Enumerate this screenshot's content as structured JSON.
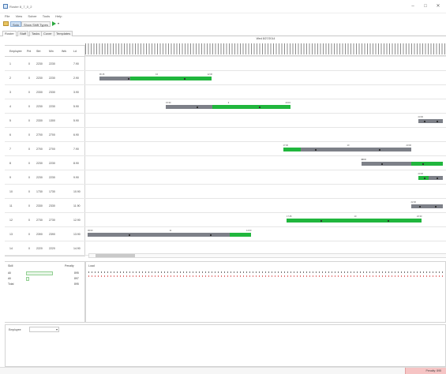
{
  "window": {
    "title": "Roster 8_7_0_2"
  },
  "menu": [
    "File",
    "View",
    "Solver",
    "Tools",
    "Help"
  ],
  "toolbar": {
    "buttons": [
      "Solo",
      "Show Shift Types"
    ]
  },
  "tabs": [
    "Roster",
    "Staff",
    "Tasks",
    "Cover",
    "Templates"
  ],
  "date_header": "Wed 8/27/2014",
  "employee_table": {
    "headers": [
      "Employee",
      "Pnt",
      "Strt",
      "Min",
      "Wrk",
      "Ld"
    ],
    "rows": [
      {
        "id": "1",
        "pnt": "0",
        "start": "2230",
        "min": "2230",
        "work": "",
        "load": "7.90"
      },
      {
        "id": "2",
        "pnt": "0",
        "start": "2230",
        "min": "2230",
        "work": "",
        "load": "2.90"
      },
      {
        "id": "3",
        "pnt": "0",
        "start": "2330",
        "min": "2330",
        "work": "",
        "load": "3.90"
      },
      {
        "id": "4",
        "pnt": "0",
        "start": "2230",
        "min": "2230",
        "work": "",
        "load": "5.90"
      },
      {
        "id": "5",
        "pnt": "0",
        "start": "2330",
        "min": "1300",
        "work": "",
        "load": "5.90"
      },
      {
        "id": "6",
        "pnt": "0",
        "start": "2700",
        "min": "2700",
        "work": "",
        "load": "6.90"
      },
      {
        "id": "7",
        "pnt": "0",
        "start": "2700",
        "min": "2700",
        "work": "",
        "load": "7.90"
      },
      {
        "id": "8",
        "pnt": "0",
        "start": "2230",
        "min": "2230",
        "work": "",
        "load": "8.90"
      },
      {
        "id": "9",
        "pnt": "0",
        "start": "2230",
        "min": "2230",
        "work": "",
        "load": "9.90"
      },
      {
        "id": "10",
        "pnt": "0",
        "start": "1730",
        "min": "1730",
        "work": "",
        "load": "10.90"
      },
      {
        "id": "11",
        "pnt": "0",
        "start": "2330",
        "min": "2330",
        "work": "",
        "load": "11.90"
      },
      {
        "id": "12",
        "pnt": "0",
        "start": "2730",
        "min": "2730",
        "work": "",
        "load": "12.90"
      },
      {
        "id": "13",
        "pnt": "0",
        "start": "2390",
        "min": "2390",
        "work": "",
        "load": "13.90"
      },
      {
        "id": "14",
        "pnt": "0",
        "start": "2220",
        "min": "2220",
        "work": "",
        "load": "14.90"
      }
    ]
  },
  "shifts": [
    {
      "row": 1,
      "start": 0.033,
      "end": 0.35,
      "green": [
        0.12,
        0.35
      ],
      "labels": [
        "06:15",
        "10",
        "12:30"
      ]
    },
    {
      "row": 3,
      "start": 0.22,
      "end": 0.57,
      "green": [
        0.35,
        0.57
      ],
      "labels": [
        "15:30",
        "9",
        "20:15"
      ]
    },
    {
      "row": 4,
      "start": 0.93,
      "end": 1.0,
      "green": null,
      "labels": [
        "23:00"
      ]
    },
    {
      "row": 6,
      "start": 0.55,
      "end": 0.91,
      "green": [
        0.55,
        0.6
      ],
      "labels": [
        "17:30",
        "10",
        "23:00"
      ]
    },
    {
      "row": 7,
      "start": 0.77,
      "end": 1.0,
      "green": [
        0.91,
        1.0
      ],
      "labels": [
        "20:00",
        "10"
      ]
    },
    {
      "row": 8,
      "start": 0.93,
      "end": 1.0,
      "green": [
        0.93,
        0.96
      ],
      "labels": [
        "23:30"
      ]
    },
    {
      "row": 10,
      "start": 0.91,
      "end": 1.0,
      "green": null,
      "labels": [
        "22:30"
      ]
    },
    {
      "row": 11,
      "start": 0.56,
      "end": 0.94,
      "green": [
        0.56,
        0.94
      ],
      "labels": [
        "17:45",
        "10",
        "22:30"
      ]
    },
    {
      "row": 12,
      "start": 0.0,
      "end": 0.46,
      "green": [
        0.4,
        0.46
      ],
      "labels": [
        "06:00",
        "11",
        "14:00"
      ]
    }
  ],
  "skills": {
    "headers": [
      "Skill",
      "Penalty"
    ],
    "rows": [
      {
        "skill": "All",
        "penalty": "895"
      },
      {
        "skill": "All",
        "penalty": "897"
      },
      {
        "skill": "Total",
        "penalty": "895"
      }
    ]
  },
  "load_panel": {
    "label": "Load"
  },
  "bottom_panel": {
    "label": "Employee"
  },
  "status": {
    "penalty": "Penalty: 895"
  }
}
